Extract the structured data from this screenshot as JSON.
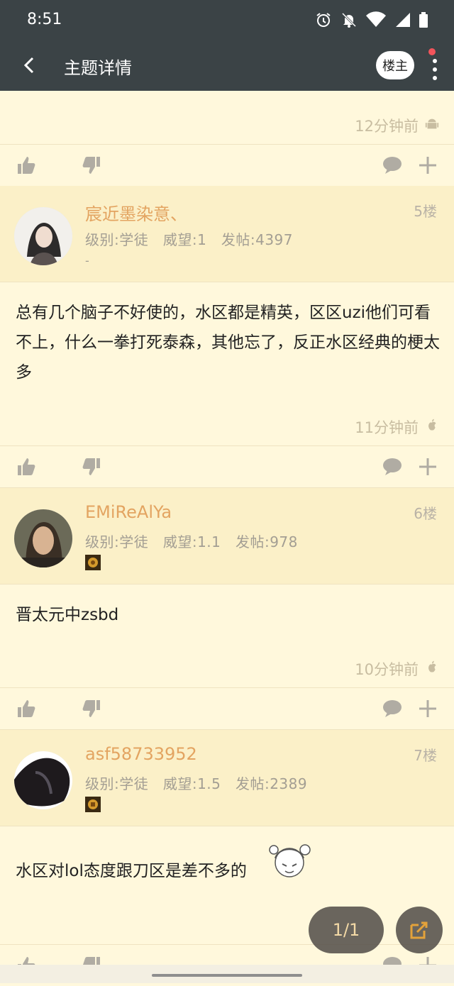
{
  "status_bar": {
    "time": "8:51",
    "icons": [
      "alarm-icon",
      "notifications-off-icon",
      "wifi-icon",
      "signal-icon",
      "battery-icon"
    ]
  },
  "app_bar": {
    "title": "主题详情",
    "owner_label": "楼主"
  },
  "top_post": {
    "time": "12分钟前",
    "os_icon": "android-icon"
  },
  "posts": [
    {
      "username": "宸近墨染意、",
      "floor": "5楼",
      "level": "级别:学徒",
      "prestige": "威望:1",
      "post_count": "发帖:4397",
      "signature": "-",
      "content": "总有几个脑子不好使的，水区都是精英，区区uzi他们可看不上，什么一拳打死泰森，其他忘了，反正水区经典的梗太多",
      "time": "11分钟前",
      "os_icon": "apple-icon"
    },
    {
      "username": "EMiReAlYa",
      "floor": "6楼",
      "level": "级别:学徒",
      "prestige": "威望:1.1",
      "post_count": "发帖:978",
      "content": "晋太元中zsbd",
      "time": "10分钟前",
      "os_icon": "apple-icon"
    },
    {
      "username": "asf58733952",
      "floor": "7楼",
      "level": "级别:学徒",
      "prestige": "威望:1.5",
      "post_count": "发帖:2389",
      "content": "水区对lol态度跟刀区是差不多的"
    }
  ],
  "pager": {
    "label": "1/1"
  },
  "colors": {
    "appbar": "#3b4346",
    "background": "#fff8dc",
    "user_header": "#fbf0c8",
    "username": "#e3a461",
    "meta_text": "#a39e93",
    "icon_gray": "#b0aca3"
  }
}
